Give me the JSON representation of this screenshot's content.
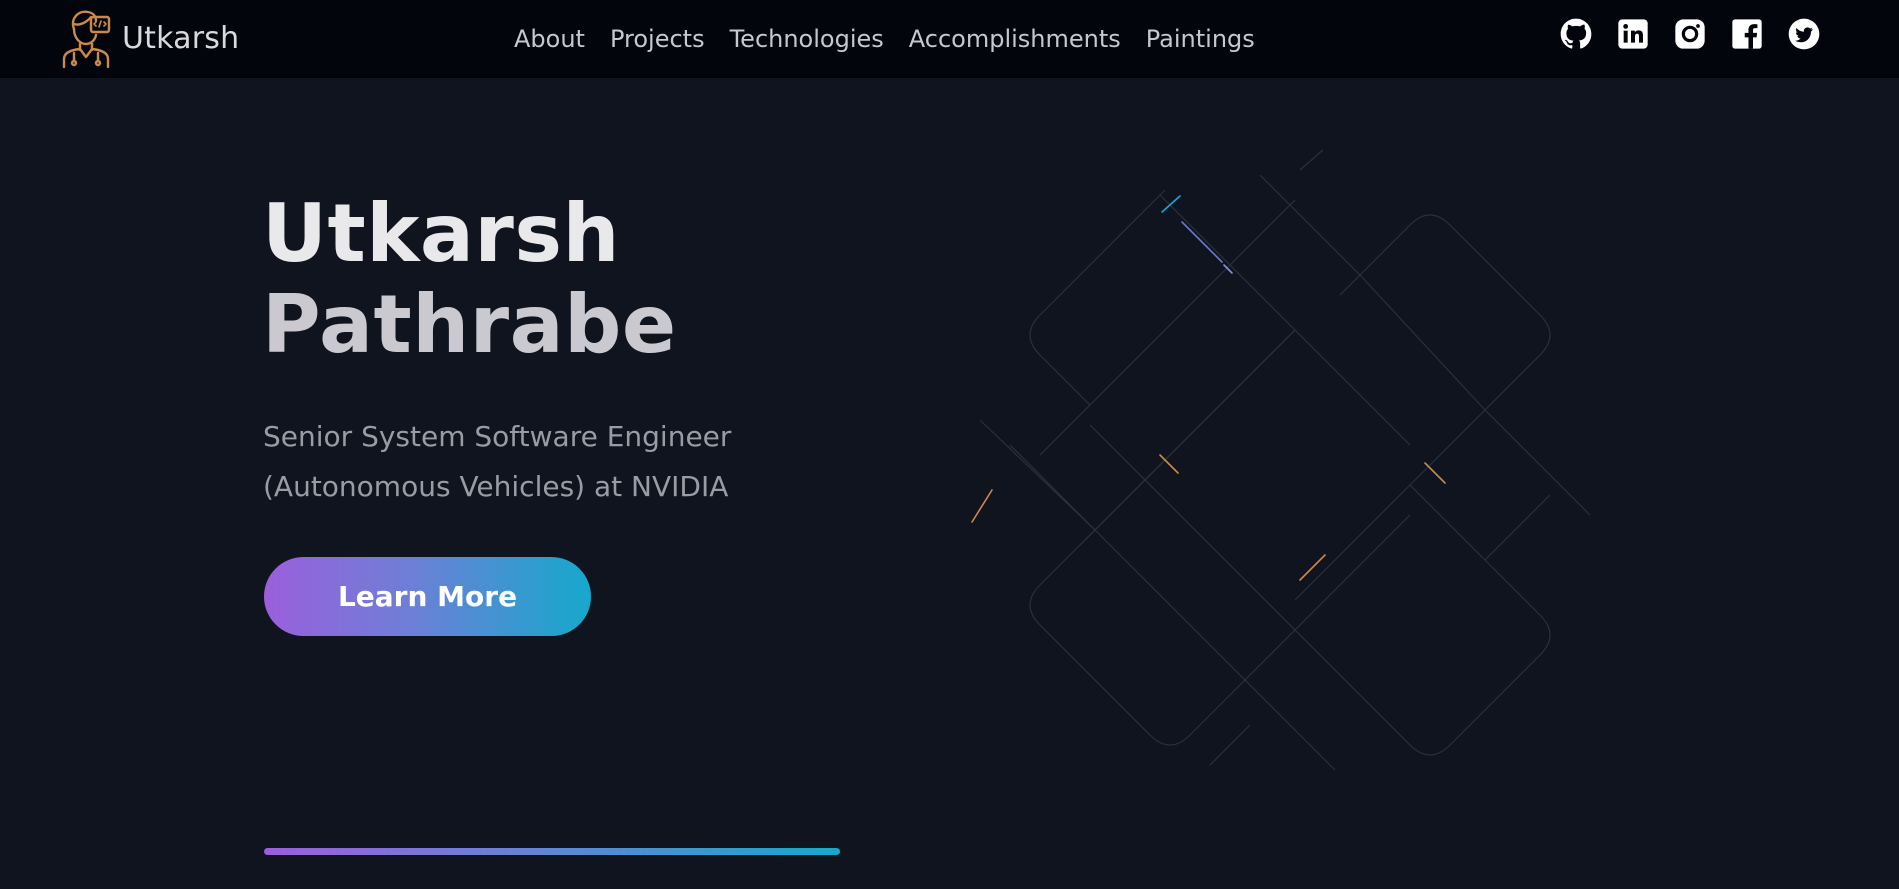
{
  "header": {
    "brand": {
      "name": "Utkarsh",
      "logo_icon": "developer-avatar-icon"
    },
    "nav": [
      {
        "label": "About"
      },
      {
        "label": "Projects"
      },
      {
        "label": "Technologies"
      },
      {
        "label": "Accomplishments"
      },
      {
        "label": "Paintings"
      }
    ],
    "social": [
      {
        "icon": "github-icon"
      },
      {
        "icon": "linkedin-icon"
      },
      {
        "icon": "instagram-icon"
      },
      {
        "icon": "facebook-icon"
      },
      {
        "icon": "twitter-icon"
      }
    ]
  },
  "hero": {
    "name_line1": "Utkarsh",
    "name_line2": "Pathrabe",
    "subtitle_line1": "Senior System Software Engineer",
    "subtitle_line2": "(Autonomous Vehicles) at NVIDIA",
    "cta_label": "Learn More"
  },
  "colors": {
    "header_bg": "#03050d",
    "page_bg": "#0f141f",
    "accent_purple": "#9b5fdc",
    "accent_cyan": "#15a9cc",
    "logo_orange": "#c98a4b"
  }
}
